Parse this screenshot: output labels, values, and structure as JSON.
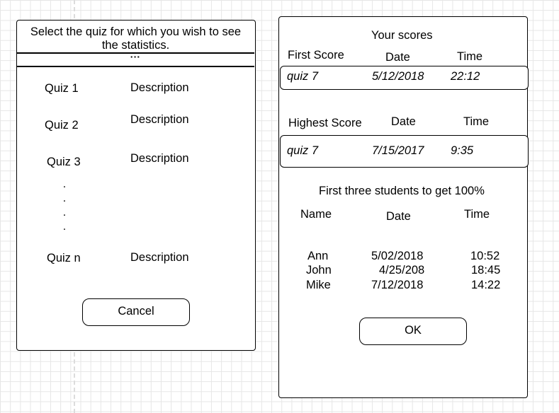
{
  "left_dialog": {
    "title": "Select the quiz for which you wish to see the statistics.",
    "title_line1": "Select the quiz for which you wish to see",
    "title_line2": "the statistics.",
    "menu_glyph": "▪▪▪",
    "quizzes": [
      {
        "name": "Quiz 1",
        "description": "Description"
      },
      {
        "name": "Quiz 2",
        "description": "Description"
      },
      {
        "name": "Quiz 3",
        "description": "Description"
      },
      {
        "name": "Quiz n",
        "description": "Description"
      }
    ],
    "ellipsis_dots": ".",
    "cancel_label": "Cancel"
  },
  "right_dialog": {
    "title": "Your scores",
    "first_score": {
      "header_label": "First Score",
      "header_date": "Date",
      "header_time": "Time",
      "quiz": "quiz 7",
      "date": "5/12/2018",
      "time": "22:12"
    },
    "highest_score": {
      "header_label": "Highest Score",
      "header_date": "Date",
      "header_time": "Time",
      "quiz": "quiz 7",
      "date": "7/15/2017",
      "time": "9:35"
    },
    "students_title": "First three students to get 100%",
    "students_headers": {
      "name": "Name",
      "date": "Date",
      "time": "Time"
    },
    "students": [
      {
        "name": "Ann",
        "date": "5/02/2018",
        "time": "10:52"
      },
      {
        "name": "John",
        "date": "4/25/208",
        "time": "18:45"
      },
      {
        "name": "Mike",
        "date": "7/12/2018",
        "time": "14:22"
      }
    ],
    "ok_label": "OK"
  }
}
